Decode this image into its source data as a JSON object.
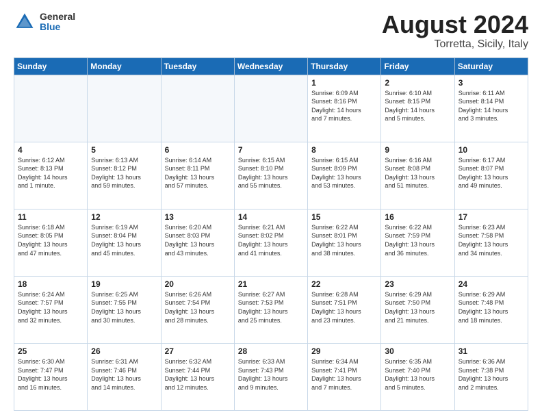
{
  "header": {
    "logo_general": "General",
    "logo_blue": "Blue",
    "title": "August 2024",
    "location": "Torretta, Sicily, Italy"
  },
  "calendar": {
    "days_of_week": [
      "Sunday",
      "Monday",
      "Tuesday",
      "Wednesday",
      "Thursday",
      "Friday",
      "Saturday"
    ],
    "weeks": [
      [
        {
          "day": "",
          "detail": ""
        },
        {
          "day": "",
          "detail": ""
        },
        {
          "day": "",
          "detail": ""
        },
        {
          "day": "",
          "detail": ""
        },
        {
          "day": "1",
          "detail": "Sunrise: 6:09 AM\nSunset: 8:16 PM\nDaylight: 14 hours\nand 7 minutes."
        },
        {
          "day": "2",
          "detail": "Sunrise: 6:10 AM\nSunset: 8:15 PM\nDaylight: 14 hours\nand 5 minutes."
        },
        {
          "day": "3",
          "detail": "Sunrise: 6:11 AM\nSunset: 8:14 PM\nDaylight: 14 hours\nand 3 minutes."
        }
      ],
      [
        {
          "day": "4",
          "detail": "Sunrise: 6:12 AM\nSunset: 8:13 PM\nDaylight: 14 hours\nand 1 minute."
        },
        {
          "day": "5",
          "detail": "Sunrise: 6:13 AM\nSunset: 8:12 PM\nDaylight: 13 hours\nand 59 minutes."
        },
        {
          "day": "6",
          "detail": "Sunrise: 6:14 AM\nSunset: 8:11 PM\nDaylight: 13 hours\nand 57 minutes."
        },
        {
          "day": "7",
          "detail": "Sunrise: 6:15 AM\nSunset: 8:10 PM\nDaylight: 13 hours\nand 55 minutes."
        },
        {
          "day": "8",
          "detail": "Sunrise: 6:15 AM\nSunset: 8:09 PM\nDaylight: 13 hours\nand 53 minutes."
        },
        {
          "day": "9",
          "detail": "Sunrise: 6:16 AM\nSunset: 8:08 PM\nDaylight: 13 hours\nand 51 minutes."
        },
        {
          "day": "10",
          "detail": "Sunrise: 6:17 AM\nSunset: 8:07 PM\nDaylight: 13 hours\nand 49 minutes."
        }
      ],
      [
        {
          "day": "11",
          "detail": "Sunrise: 6:18 AM\nSunset: 8:05 PM\nDaylight: 13 hours\nand 47 minutes."
        },
        {
          "day": "12",
          "detail": "Sunrise: 6:19 AM\nSunset: 8:04 PM\nDaylight: 13 hours\nand 45 minutes."
        },
        {
          "day": "13",
          "detail": "Sunrise: 6:20 AM\nSunset: 8:03 PM\nDaylight: 13 hours\nand 43 minutes."
        },
        {
          "day": "14",
          "detail": "Sunrise: 6:21 AM\nSunset: 8:02 PM\nDaylight: 13 hours\nand 41 minutes."
        },
        {
          "day": "15",
          "detail": "Sunrise: 6:22 AM\nSunset: 8:01 PM\nDaylight: 13 hours\nand 38 minutes."
        },
        {
          "day": "16",
          "detail": "Sunrise: 6:22 AM\nSunset: 7:59 PM\nDaylight: 13 hours\nand 36 minutes."
        },
        {
          "day": "17",
          "detail": "Sunrise: 6:23 AM\nSunset: 7:58 PM\nDaylight: 13 hours\nand 34 minutes."
        }
      ],
      [
        {
          "day": "18",
          "detail": "Sunrise: 6:24 AM\nSunset: 7:57 PM\nDaylight: 13 hours\nand 32 minutes."
        },
        {
          "day": "19",
          "detail": "Sunrise: 6:25 AM\nSunset: 7:55 PM\nDaylight: 13 hours\nand 30 minutes."
        },
        {
          "day": "20",
          "detail": "Sunrise: 6:26 AM\nSunset: 7:54 PM\nDaylight: 13 hours\nand 28 minutes."
        },
        {
          "day": "21",
          "detail": "Sunrise: 6:27 AM\nSunset: 7:53 PM\nDaylight: 13 hours\nand 25 minutes."
        },
        {
          "day": "22",
          "detail": "Sunrise: 6:28 AM\nSunset: 7:51 PM\nDaylight: 13 hours\nand 23 minutes."
        },
        {
          "day": "23",
          "detail": "Sunrise: 6:29 AM\nSunset: 7:50 PM\nDaylight: 13 hours\nand 21 minutes."
        },
        {
          "day": "24",
          "detail": "Sunrise: 6:29 AM\nSunset: 7:48 PM\nDaylight: 13 hours\nand 18 minutes."
        }
      ],
      [
        {
          "day": "25",
          "detail": "Sunrise: 6:30 AM\nSunset: 7:47 PM\nDaylight: 13 hours\nand 16 minutes."
        },
        {
          "day": "26",
          "detail": "Sunrise: 6:31 AM\nSunset: 7:46 PM\nDaylight: 13 hours\nand 14 minutes."
        },
        {
          "day": "27",
          "detail": "Sunrise: 6:32 AM\nSunset: 7:44 PM\nDaylight: 13 hours\nand 12 minutes."
        },
        {
          "day": "28",
          "detail": "Sunrise: 6:33 AM\nSunset: 7:43 PM\nDaylight: 13 hours\nand 9 minutes."
        },
        {
          "day": "29",
          "detail": "Sunrise: 6:34 AM\nSunset: 7:41 PM\nDaylight: 13 hours\nand 7 minutes."
        },
        {
          "day": "30",
          "detail": "Sunrise: 6:35 AM\nSunset: 7:40 PM\nDaylight: 13 hours\nand 5 minutes."
        },
        {
          "day": "31",
          "detail": "Sunrise: 6:36 AM\nSunset: 7:38 PM\nDaylight: 13 hours\nand 2 minutes."
        }
      ]
    ]
  }
}
